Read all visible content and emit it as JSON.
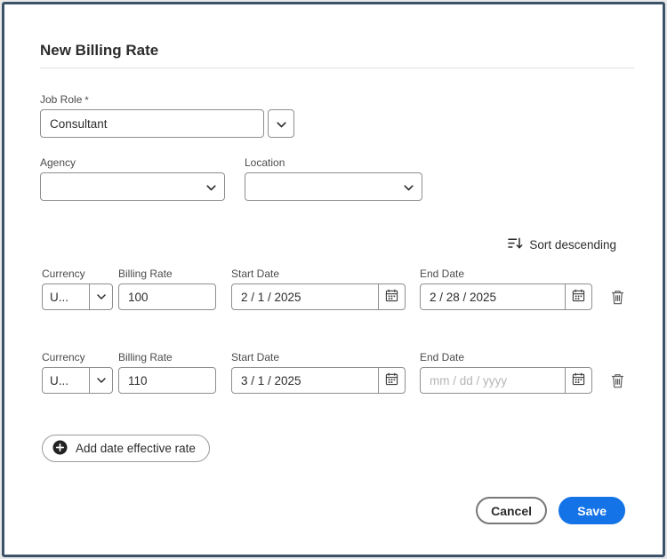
{
  "dialog": {
    "title": "New Billing Rate"
  },
  "job_role": {
    "label": "Job Role",
    "required_marker": "*",
    "value": "Consultant"
  },
  "agency": {
    "label": "Agency",
    "value": ""
  },
  "location": {
    "label": "Location",
    "value": ""
  },
  "sort": {
    "label": "Sort descending"
  },
  "columns": {
    "currency": "Currency",
    "billing_rate": "Billing Rate",
    "start_date": "Start Date",
    "end_date": "End Date"
  },
  "rows": [
    {
      "currency": "U...",
      "billing_rate": "100",
      "start_date": "2 / 1 / 2025",
      "end_date": "2 / 28 / 2025",
      "end_date_placeholder": ""
    },
    {
      "currency": "U...",
      "billing_rate": "110",
      "start_date": "3 / 1 / 2025",
      "end_date": "",
      "end_date_placeholder": "mm / dd / yyyy"
    }
  ],
  "actions": {
    "add_rate": "Add date effective rate",
    "cancel": "Cancel",
    "save": "Save"
  },
  "colors": {
    "accent_blue": "#1473e6",
    "dialog_border": "#3c5268",
    "field_border": "#8e8e8e"
  }
}
